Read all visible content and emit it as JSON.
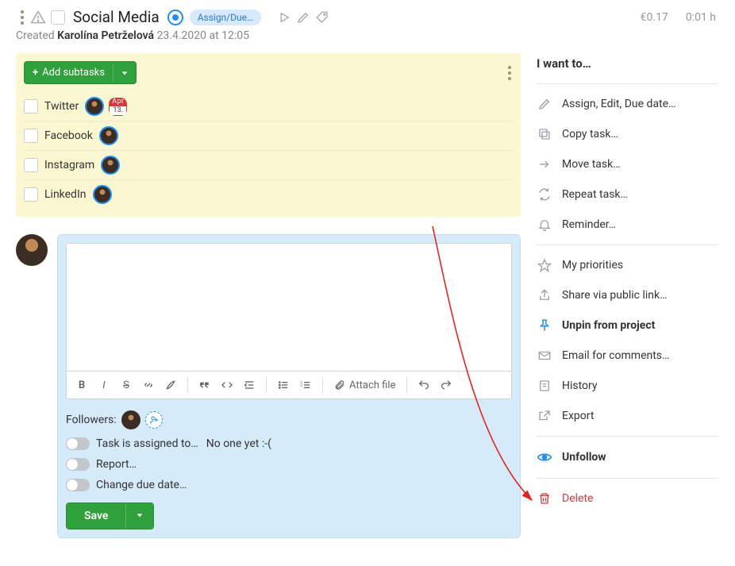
{
  "header": {
    "title": "Social Media",
    "assign_badge": "Assign/Due…",
    "cost": "€0.17",
    "time": "0:01 h"
  },
  "created": {
    "prefix": "Created",
    "author": "Karolína Petrželová",
    "timestamp": "23.4.2020 at 12:05"
  },
  "subtasks": {
    "button_label": "Add subtasks",
    "items": [
      {
        "title": "Twitter",
        "date_month": "Apr",
        "date_day": "13."
      },
      {
        "title": "Facebook"
      },
      {
        "title": "Instagram"
      },
      {
        "title": "LinkedIn"
      }
    ]
  },
  "toolbar": {
    "attach_label": "Attach file"
  },
  "followers": {
    "label": "Followers:"
  },
  "toggles": {
    "assign_label": "Task is assigned to…",
    "assign_value": "No one yet :-(",
    "report_label": "Report…",
    "due_label": "Change due date…"
  },
  "save_label": "Save",
  "sidebar": {
    "title": "I want to…",
    "items": {
      "assign": "Assign, Edit, Due date…",
      "copy": "Copy task…",
      "move": "Move task…",
      "repeat": "Repeat task…",
      "reminder": "Reminder…",
      "priorities": "My priorities",
      "share": "Share via public link…",
      "unpin": "Unpin from project",
      "email": "Email for comments…",
      "history": "History",
      "export": "Export",
      "unfollow": "Unfollow",
      "delete": "Delete"
    }
  }
}
